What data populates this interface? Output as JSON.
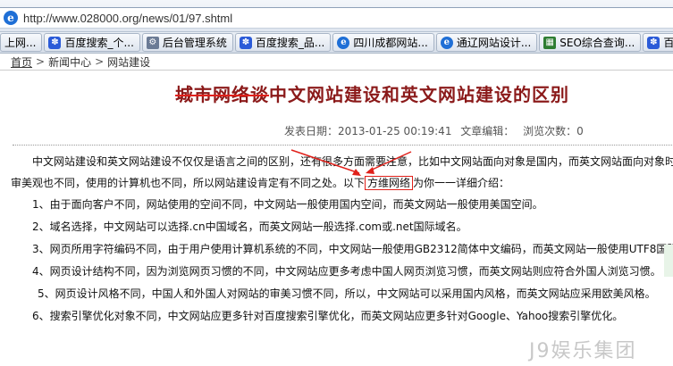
{
  "browser": {
    "url": "http://www.028000.org/news/01/97.shtml"
  },
  "tabs": [
    {
      "label": "上网...",
      "icon": "paw-icon"
    },
    {
      "label": "百度搜索_个...",
      "icon": "paw-icon"
    },
    {
      "label": "后台管理系统",
      "icon": "gear-icon"
    },
    {
      "label": "百度搜索_品...",
      "icon": "paw-icon"
    },
    {
      "label": "四川成都网站...",
      "icon": "ie-icon"
    },
    {
      "label": "通辽网站设计...",
      "icon": "ie-icon"
    },
    {
      "label": "SEO综合查询...",
      "icon": "seo-icon"
    },
    {
      "label": "百度",
      "icon": "paw-icon"
    }
  ],
  "breadcrumb": {
    "home": "首页",
    "sep": ">",
    "news": "新闻中心",
    "current": "网站建设"
  },
  "article": {
    "title_struck": "城市网络谈",
    "title_main": "中文网站建设和英文网站建设的区别",
    "meta": {
      "date_label": "发表日期：2013-01-25 00:19:41",
      "editor_label": "文章编辑：",
      "views_label": "浏览次数：0"
    },
    "intro_line1": "中文网站建设和英文网站建设不仅仅是语言之间的区别，还有很多方面需要注意，比如中文网站面向对象是国内，而英文网站面向对象时",
    "intro_line2_a": "审美观也不同，使用的计算机也不同，所以网站建设肯定有不同之处。以下",
    "intro_line2_circled": "方维网络",
    "intro_line2_b": "为你一一详细介绍：",
    "items": [
      "1、由于面向客户不同，网站使用的空间不同，中文网站一般使用国内空间，而英文网站一般使用美国空间。",
      "2、域名选择，中文网站可以选择.cn中国域名，而英文网站一般选择.com或.net国际域名。",
      "3、网页所用字符编码不同，由于用户使用计算机系统的不同，中文网站一般使用GB2312简体中文编码，而英文网站一般使用UTF8国际编",
      "4、网页设计结构不同，因为浏览网页习惯的不同，中文网站应更多考虑中国人网页浏览习惯，而英文网站则应符合外国人浏览习惯。",
      "5、网页设计风格不同，中国人和外国人对网站的审美习惯不同，所以，中文网站可以采用国内风格，而英文网站应采用欧美风格。",
      "6、搜索引擎优化对象不同，中文网站应更多针对百度搜索引擎优化，而英文网站应更多针对Google、Yahoo搜索引擎优化。"
    ]
  },
  "watermark": "J9娱乐集团",
  "colors": {
    "title": "#8b1a1a",
    "annotation": "#e0201a"
  }
}
